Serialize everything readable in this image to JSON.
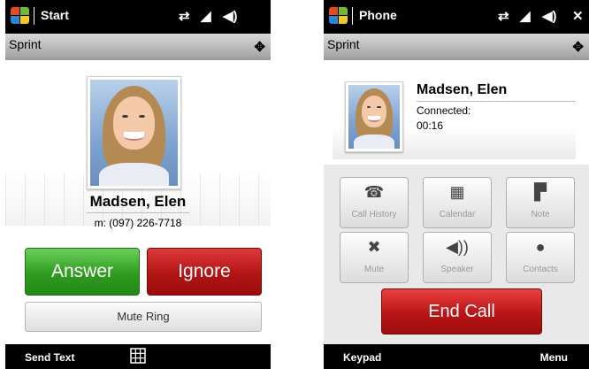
{
  "colors": {
    "status_bar": "#000000",
    "answer_green": "#2f9a1f",
    "ignore_red": "#b21414",
    "end_call_red": "#b81515",
    "win_red": "#e84a1d",
    "win_green": "#6dbb2e",
    "win_blue": "#2a84d8",
    "win_yellow": "#f6c71c"
  },
  "left": {
    "status": {
      "title": "Start",
      "icons": [
        "sync-icon",
        "signal-icon",
        "volume-icon"
      ]
    },
    "carrier": {
      "name": "Sprint",
      "icon": "roaming-icon"
    },
    "contact": {
      "name": "Madsen, Elen",
      "number": "m: (097) 226-7718"
    },
    "buttons": {
      "answer": "Answer",
      "ignore": "Ignore",
      "mute_ring": "Mute Ring"
    },
    "softkeys": {
      "left": "Send Text",
      "center_icon": "keypad-grid-icon"
    }
  },
  "right": {
    "status": {
      "title": "Phone",
      "icons": [
        "sync-icon",
        "signal-icon",
        "volume-icon",
        "close-icon"
      ]
    },
    "carrier": {
      "name": "Sprint",
      "icon": "roaming-icon"
    },
    "contact": {
      "name": "Madsen, Elen",
      "state": "Connected:",
      "duration": "00:16"
    },
    "tiles": [
      {
        "label": "Call History",
        "icon": "call-history-icon"
      },
      {
        "label": "Calendar",
        "icon": "calendar-icon"
      },
      {
        "label": "Note",
        "icon": "note-icon"
      },
      {
        "label": "Mute",
        "icon": "mute-icon"
      },
      {
        "label": "Speaker",
        "icon": "speaker-icon"
      },
      {
        "label": "Contacts",
        "icon": "contacts-icon"
      }
    ],
    "end_call": "End Call",
    "softkeys": {
      "left": "Keypad",
      "right": "Menu"
    }
  }
}
